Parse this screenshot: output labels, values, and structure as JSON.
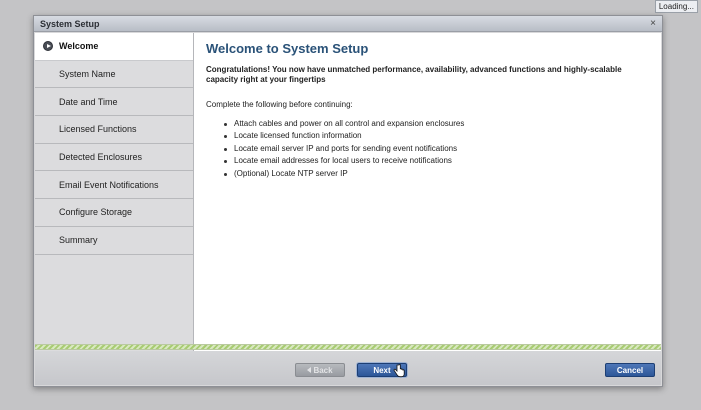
{
  "loading_badge": "Loading...",
  "window": {
    "title": "System Setup",
    "close_glyph": "×"
  },
  "sidebar": {
    "items": [
      {
        "label": "Welcome",
        "active": true,
        "icon": "arrow-circle-icon"
      },
      {
        "label": "System Name"
      },
      {
        "label": "Date and Time"
      },
      {
        "label": "Licensed Functions"
      },
      {
        "label": "Detected Enclosures"
      },
      {
        "label": "Email Event Notifications"
      },
      {
        "label": "Configure Storage"
      },
      {
        "label": "Summary"
      }
    ]
  },
  "main": {
    "heading": "Welcome to System Setup",
    "intro": "Congratulations! You now have unmatched performance, availability, advanced functions and highly-scalable capacity right at your fingertips",
    "instructions": "Complete the following before continuing:",
    "checklist": [
      "Attach cables and power on all control and expansion enclosures",
      "Locate licensed function information",
      "Locate email server IP and ports for sending event notifications",
      "Locate email addresses for local users to receive notifications",
      "(Optional) Locate NTP server IP"
    ]
  },
  "footer": {
    "back_label": "Back",
    "next_label": "Next",
    "cancel_label": "Cancel"
  },
  "colors": {
    "heading": "#2a5278",
    "primary_button": "#2d5798",
    "progress_stripe": "#a8cc72"
  }
}
